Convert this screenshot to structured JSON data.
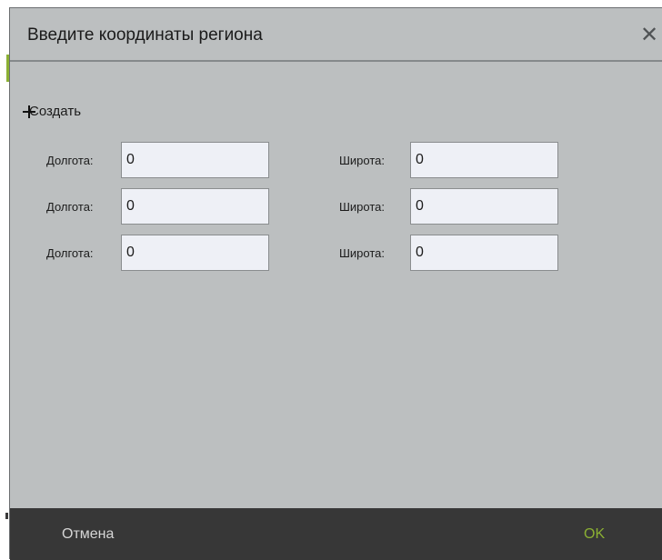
{
  "dialog": {
    "title": "Введите координаты региона",
    "close_glyph": "✕"
  },
  "create": {
    "label": "Создать",
    "icon": "plus-icon"
  },
  "rows": [
    {
      "lon_label": "Долгота:",
      "lon_value": "0",
      "lat_label": "Широта:",
      "lat_value": "0"
    },
    {
      "lon_label": "Долгота:",
      "lon_value": "0",
      "lat_label": "Широта:",
      "lat_value": "0"
    },
    {
      "lon_label": "Долгота:",
      "lon_value": "0",
      "lat_label": "Широта:",
      "lat_value": "0"
    }
  ],
  "footer": {
    "cancel_label": "Отмена",
    "ok_label": "OK"
  },
  "colors": {
    "background": "#bcbfc0",
    "footer": "#373737",
    "ok_accent": "#8bb033",
    "field": "#eef0f6"
  }
}
